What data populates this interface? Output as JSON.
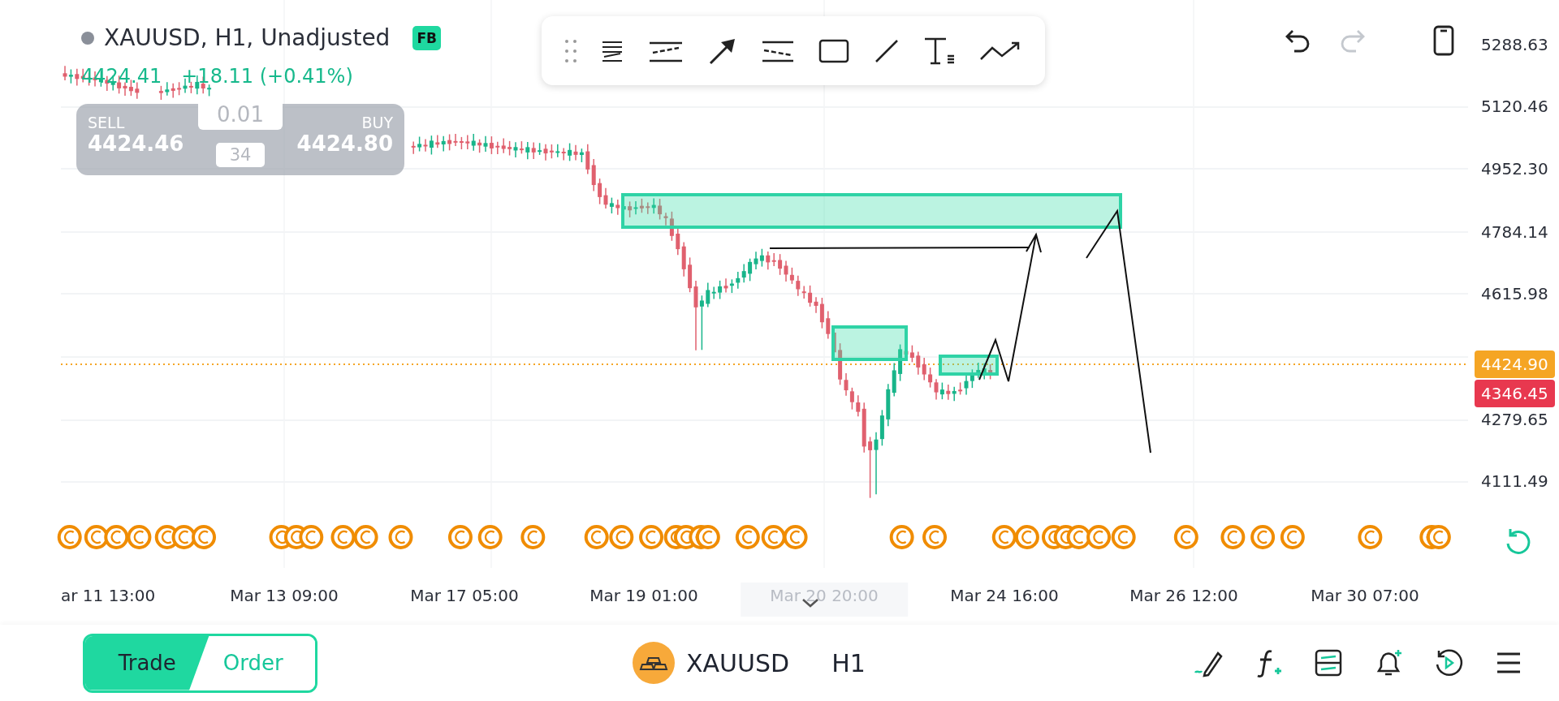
{
  "header": {
    "title": "XAUUSD, H1, Unadjusted",
    "badge": "FB",
    "price": "4424.41",
    "change": "+18.11 (+0.41%)"
  },
  "trade_panel": {
    "sell_label": "SELL",
    "sell_price": "4424.46",
    "lot": "0.01",
    "spread": "34",
    "buy_label": "BUY",
    "buy_price": "4424.80"
  },
  "top_actions": [
    {
      "kind": "undo",
      "disabled": false
    },
    {
      "kind": "redo",
      "disabled": true
    },
    {
      "kind": "layout",
      "disabled": false
    }
  ],
  "price_axis": [
    "5288.63",
    "5120.46",
    "4952.30",
    "4784.14",
    "4615.98",
    "4279.65",
    "4111.49"
  ],
  "price_tags": [
    {
      "label": "4424.90",
      "color": "#f5a524"
    },
    {
      "label": "4346.45",
      "color": "#e8384f"
    }
  ],
  "time_axis": [
    {
      "label": "ar 11 13:00",
      "selected": false
    },
    {
      "label": "Mar 13 09:00",
      "selected": false
    },
    {
      "label": "Mar 17 05:00",
      "selected": false
    },
    {
      "label": "Mar 19 01:00",
      "selected": false
    },
    {
      "label": "Mar 20 20:00",
      "selected": true
    },
    {
      "label": "Mar 24 16:00",
      "selected": false
    },
    {
      "label": "Mar 26 12:00",
      "selected": false
    },
    {
      "label": "Mar 30 07:00",
      "selected": false
    }
  ],
  "bottom_bar": {
    "modes": [
      {
        "label": "Trade",
        "selected": true
      },
      {
        "label": "Order",
        "selected": false
      }
    ],
    "symbol": "XAUUSD",
    "timeframe": "H1"
  }
}
